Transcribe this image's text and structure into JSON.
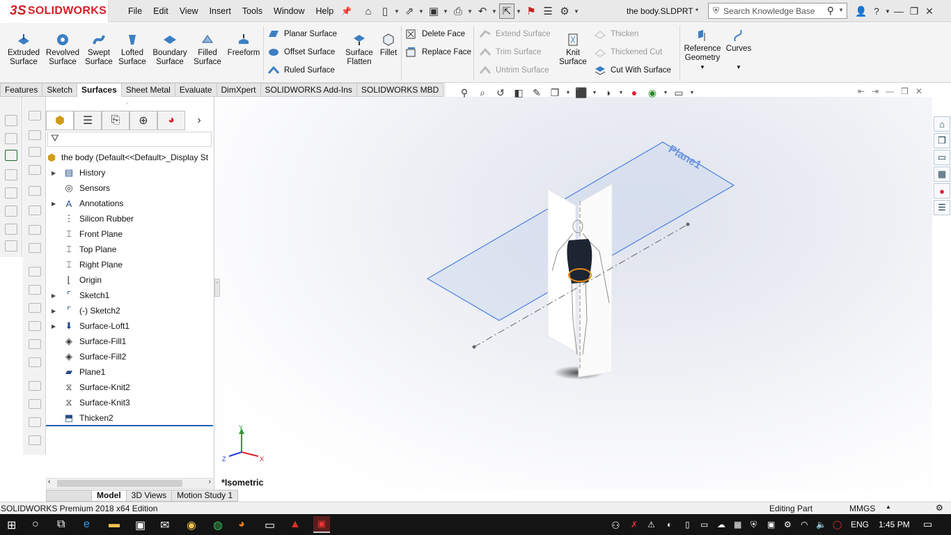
{
  "app": {
    "logo_ds": "3S",
    "logo_text": "SOLIDWORKS",
    "document_title": "the body.SLDPRT *"
  },
  "menu": [
    "File",
    "Edit",
    "View",
    "Insert",
    "Tools",
    "Window",
    "Help"
  ],
  "search": {
    "placeholder": "Search Knowledge Base"
  },
  "ribbon": {
    "extruded_surface": [
      "Extruded",
      "Surface"
    ],
    "revolved_surface": [
      "Revolved",
      "Surface"
    ],
    "swept_surface": [
      "Swept",
      "Surface"
    ],
    "lofted_surface": [
      "Lofted",
      "Surface"
    ],
    "boundary_surface": [
      "Boundary",
      "Surface"
    ],
    "filled_surface": [
      "Filled",
      "Surface"
    ],
    "freeform": "Freeform",
    "planar_surface": "Planar Surface",
    "offset_surface": "Offset Surface",
    "ruled_surface": "Ruled Surface",
    "surface_flatten": [
      "Surface",
      "Flatten"
    ],
    "fillet": "Fillet",
    "delete_face": "Delete Face",
    "replace_face": "Replace Face",
    "extend_surface": "Extend Surface",
    "trim_surface": "Trim Surface",
    "untrim_surface": "Untrim Surface",
    "knit_surface": [
      "Knit",
      "Surface"
    ],
    "thicken": "Thicken",
    "thickened_cut": "Thickened Cut",
    "cut_with_surface": "Cut With Surface",
    "reference_geometry": [
      "Reference",
      "Geometry"
    ],
    "curves": "Curves"
  },
  "tabs": [
    "Features",
    "Sketch",
    "Surfaces",
    "Sheet Metal",
    "Evaluate",
    "DimXpert",
    "SOLIDWORKS Add-Ins",
    "SOLIDWORKS MBD"
  ],
  "active_tab": "Surfaces",
  "tree": {
    "root": "the body  (Default<<Default>_Display St",
    "items": [
      {
        "label": "History",
        "expand": true
      },
      {
        "label": "Sensors",
        "expand": false
      },
      {
        "label": "Annotations",
        "expand": true
      },
      {
        "label": "Silicon Rubber",
        "expand": false
      },
      {
        "label": "Front Plane",
        "expand": false
      },
      {
        "label": "Top Plane",
        "expand": false
      },
      {
        "label": "Right Plane",
        "expand": false
      },
      {
        "label": "Origin",
        "expand": false
      },
      {
        "label": "Sketch1",
        "expand": true
      },
      {
        "label": "(-) Sketch2",
        "expand": true
      },
      {
        "label": "Surface-Loft1",
        "expand": true
      },
      {
        "label": "Surface-Fill1",
        "expand": false
      },
      {
        "label": "Surface-Fill2",
        "expand": false
      },
      {
        "label": "Plane1",
        "expand": false
      },
      {
        "label": "Surface-Knit2",
        "expand": false
      },
      {
        "label": "Surface-Knit3",
        "expand": false
      },
      {
        "label": "Thicken2",
        "expand": false
      }
    ]
  },
  "bottom_tabs": [
    "Model",
    "3D Views",
    "Motion Study 1"
  ],
  "viewport": {
    "plane_label": "Plane1",
    "view_name": "*Isometric",
    "axis_x": "X",
    "axis_y": "Y",
    "axis_z": "Z"
  },
  "status": {
    "edition": "SOLIDWORKS Premium 2018 x64 Edition",
    "mode": "Editing Part",
    "units": "MMGS"
  },
  "taskbar": {
    "lang": "ENG",
    "time": "1:45 PM"
  }
}
